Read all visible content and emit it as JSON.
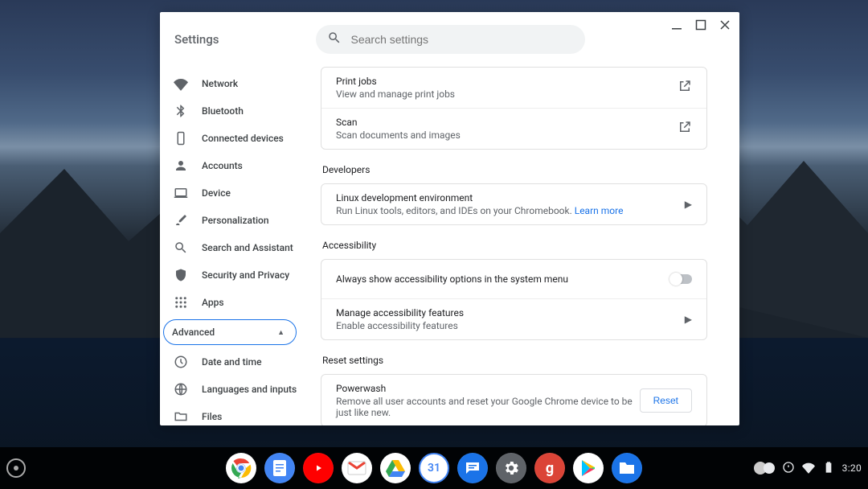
{
  "header": {
    "title": "Settings"
  },
  "search": {
    "placeholder": "Search settings"
  },
  "sidebar": {
    "items": [
      {
        "label": "Network"
      },
      {
        "label": "Bluetooth"
      },
      {
        "label": "Connected devices"
      },
      {
        "label": "Accounts"
      },
      {
        "label": "Device"
      },
      {
        "label": "Personalization"
      },
      {
        "label": "Search and Assistant"
      },
      {
        "label": "Security and Privacy"
      },
      {
        "label": "Apps"
      }
    ],
    "advanced_label": "Advanced",
    "advanced_items": [
      {
        "label": "Date and time"
      },
      {
        "label": "Languages and inputs"
      },
      {
        "label": "Files"
      }
    ]
  },
  "content": {
    "print_jobs": {
      "title": "Print jobs",
      "sub": "View and manage print jobs"
    },
    "scan": {
      "title": "Scan",
      "sub": "Scan documents and images"
    },
    "developers_header": "Developers",
    "linux": {
      "title": "Linux development environment",
      "sub": "Run Linux tools, editors, and IDEs on your Chromebook. ",
      "learn_more": "Learn more"
    },
    "accessibility_header": "Accessibility",
    "a11y_toggle": {
      "title": "Always show accessibility options in the system menu"
    },
    "a11y_manage": {
      "title": "Manage accessibility features",
      "sub": "Enable accessibility features"
    },
    "reset_header": "Reset settings",
    "powerwash": {
      "title": "Powerwash",
      "sub": "Remove all user accounts and reset your Google Chrome device to be just like new.",
      "button": "Reset"
    }
  },
  "shelf": {
    "apps": [
      "chrome",
      "docs",
      "youtube",
      "gmail",
      "drive",
      "calendar",
      "messages",
      "settings",
      "gplus",
      "play",
      "files"
    ]
  },
  "status": {
    "time": "3:20"
  }
}
